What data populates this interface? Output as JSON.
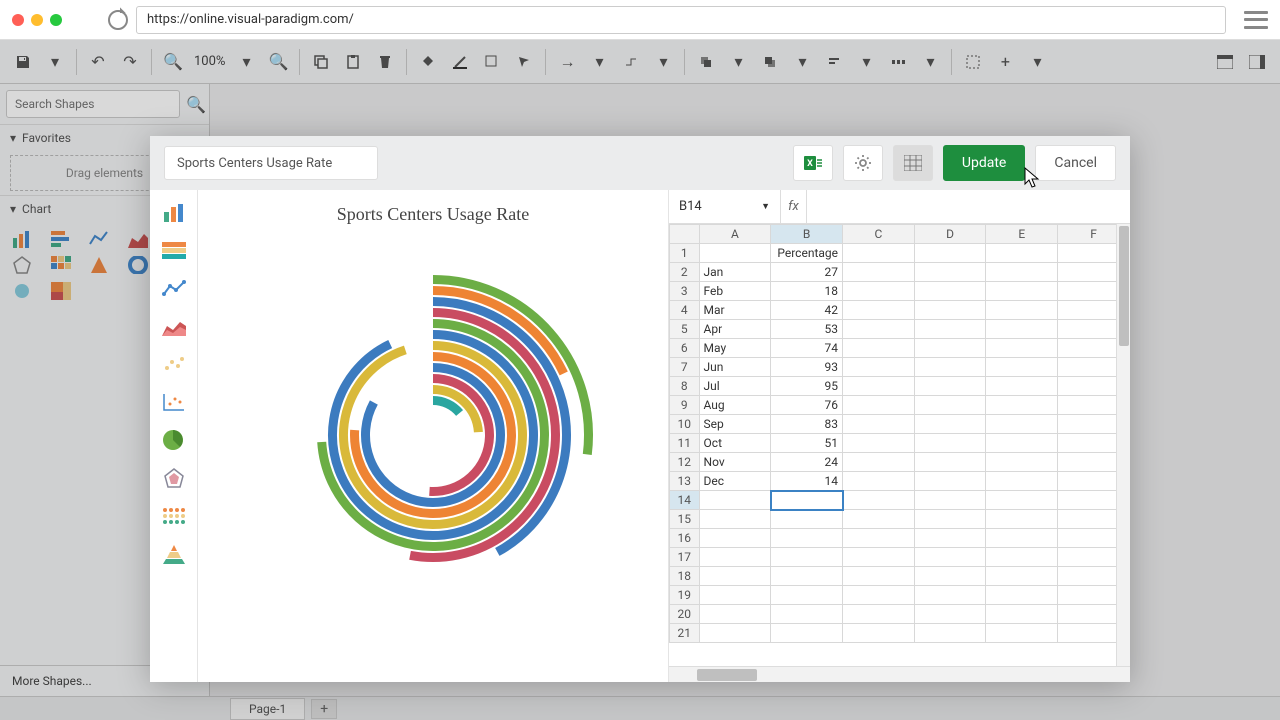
{
  "browser": {
    "url": "https://online.visual-paradigm.com/"
  },
  "toolbar": {
    "zoom": "100%"
  },
  "sidebar": {
    "search_placeholder": "Search Shapes",
    "favorites_label": "Favorites",
    "drag_hint": "Drag elements",
    "chart_label": "Chart",
    "more_shapes": "More Shapes..."
  },
  "page_tab": "Page-1",
  "dialog": {
    "title_input": "Sports Centers Usage Rate",
    "update": "Update",
    "cancel": "Cancel",
    "cell_ref": "B14",
    "fx": "fx",
    "formula": ""
  },
  "chart_data": {
    "type": "radial-bar",
    "title": "Sports Centers Usage Rate",
    "header": "Percentage",
    "categories": [
      "Jan",
      "Feb",
      "Mar",
      "Apr",
      "May",
      "Jun",
      "Jul",
      "Aug",
      "Sep",
      "Oct",
      "Nov",
      "Dec"
    ],
    "values": [
      27,
      18,
      42,
      53,
      74,
      93,
      95,
      76,
      83,
      51,
      24,
      14
    ],
    "colors": [
      "#6cae45",
      "#ee8434",
      "#3c7bbf",
      "#c94c62",
      "#6cae45",
      "#3c7bbf",
      "#d9b93a",
      "#ee8434",
      "#3c7bbf",
      "#c94c62",
      "#d9b93a",
      "#2aa6a0"
    ],
    "ylim": [
      0,
      100
    ]
  },
  "sheet": {
    "columns": [
      "A",
      "B",
      "C",
      "D",
      "E",
      "F"
    ],
    "header_row": [
      "",
      "Percentage",
      "",
      "",
      "",
      ""
    ],
    "rows": [
      [
        "Jan",
        "27",
        "",
        "",
        "",
        ""
      ],
      [
        "Feb",
        "18",
        "",
        "",
        "",
        ""
      ],
      [
        "Mar",
        "42",
        "",
        "",
        "",
        ""
      ],
      [
        "Apr",
        "53",
        "",
        "",
        "",
        ""
      ],
      [
        "May",
        "74",
        "",
        "",
        "",
        ""
      ],
      [
        "Jun",
        "93",
        "",
        "",
        "",
        ""
      ],
      [
        "Jul",
        "95",
        "",
        "",
        "",
        ""
      ],
      [
        "Aug",
        "76",
        "",
        "",
        "",
        ""
      ],
      [
        "Sep",
        "83",
        "",
        "",
        "",
        ""
      ],
      [
        "Oct",
        "51",
        "",
        "",
        "",
        ""
      ],
      [
        "Nov",
        "24",
        "",
        "",
        "",
        ""
      ],
      [
        "Dec",
        "14",
        "",
        "",
        "",
        ""
      ]
    ],
    "selected_cell": "B14",
    "total_rows_shown": 21
  }
}
